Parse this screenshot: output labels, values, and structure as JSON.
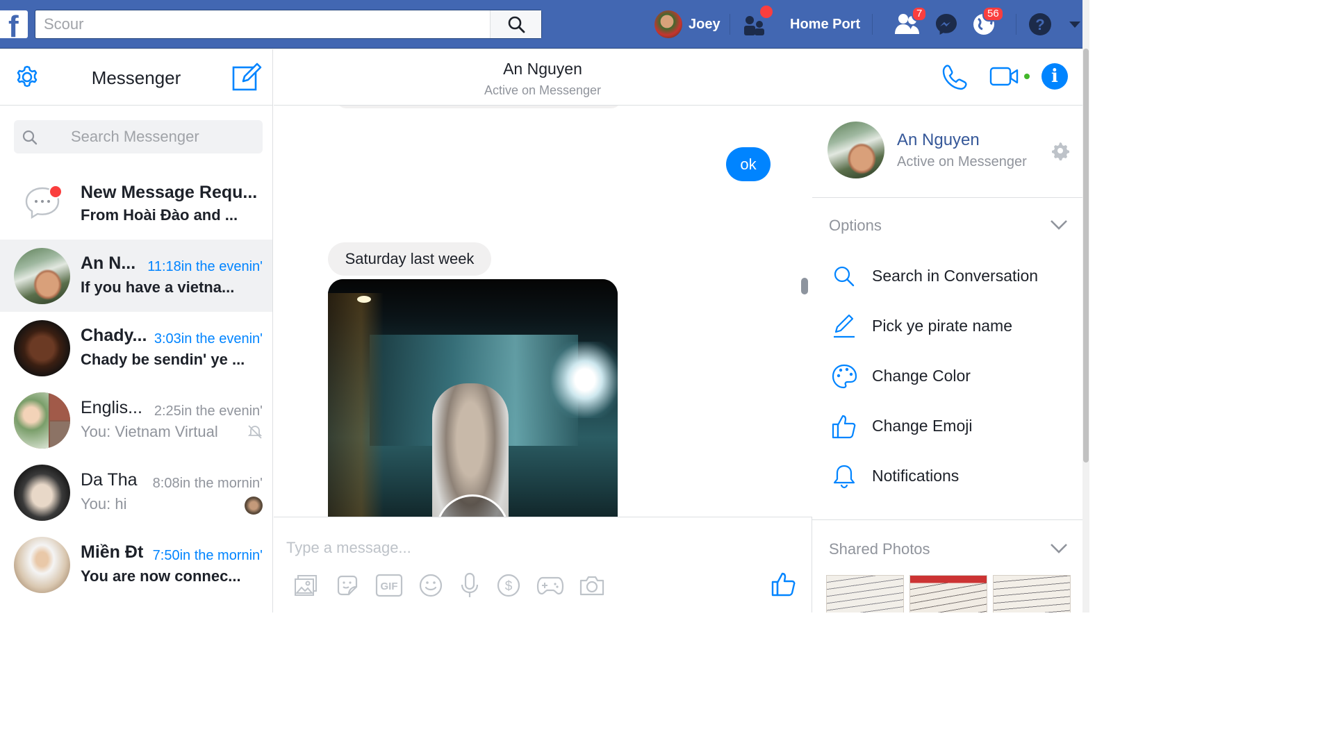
{
  "topbar": {
    "search_placeholder": "Scour",
    "user_name": "Joey",
    "home_label": "Home Port",
    "friends_badge": "7",
    "notifications_badge": "56",
    "accent_color": "#4267b2"
  },
  "left": {
    "title": "Messenger",
    "search_placeholder": "Search Messenger",
    "conversations": [
      {
        "name": "New Message Requ...",
        "time": "",
        "snippet": "From Hoài Đào and ..."
      },
      {
        "name": "An N...",
        "time": "11:18in the evenin'",
        "snippet": "If you have a vietna..."
      },
      {
        "name": "Chady...",
        "time": "3:03in the evenin'",
        "snippet": "Chady be sendin' ye ..."
      },
      {
        "name": "Englis...",
        "time": "2:25in the evenin'",
        "snippet": "You: Vietnam Virtual"
      },
      {
        "name": "Da Tha",
        "time": "8:08in the mornin'",
        "snippet": "You: hi"
      },
      {
        "name": "Miền Đt",
        "time": "7:50in the mornin'",
        "snippet": "You are now connec..."
      }
    ]
  },
  "chat": {
    "name": "An Nguyen",
    "status": "Active on Messenger",
    "messages": [
      {
        "text": "ok"
      },
      {
        "text": "Saturday last week"
      }
    ],
    "input_placeholder": "Type a message..."
  },
  "right": {
    "name": "An Nguyen",
    "status": "Active on Messenger",
    "options_title": "Options",
    "options": [
      {
        "label": "Search in Conversation",
        "icon": "search-icon"
      },
      {
        "label": "Pick ye pirate name",
        "icon": "pencil-icon"
      },
      {
        "label": "Change Color",
        "icon": "palette-icon"
      },
      {
        "label": "Change Emoji",
        "icon": "thumbs-up-icon"
      },
      {
        "label": "Notifications",
        "icon": "bell-icon"
      }
    ],
    "shared_title": "Shared Photos"
  }
}
